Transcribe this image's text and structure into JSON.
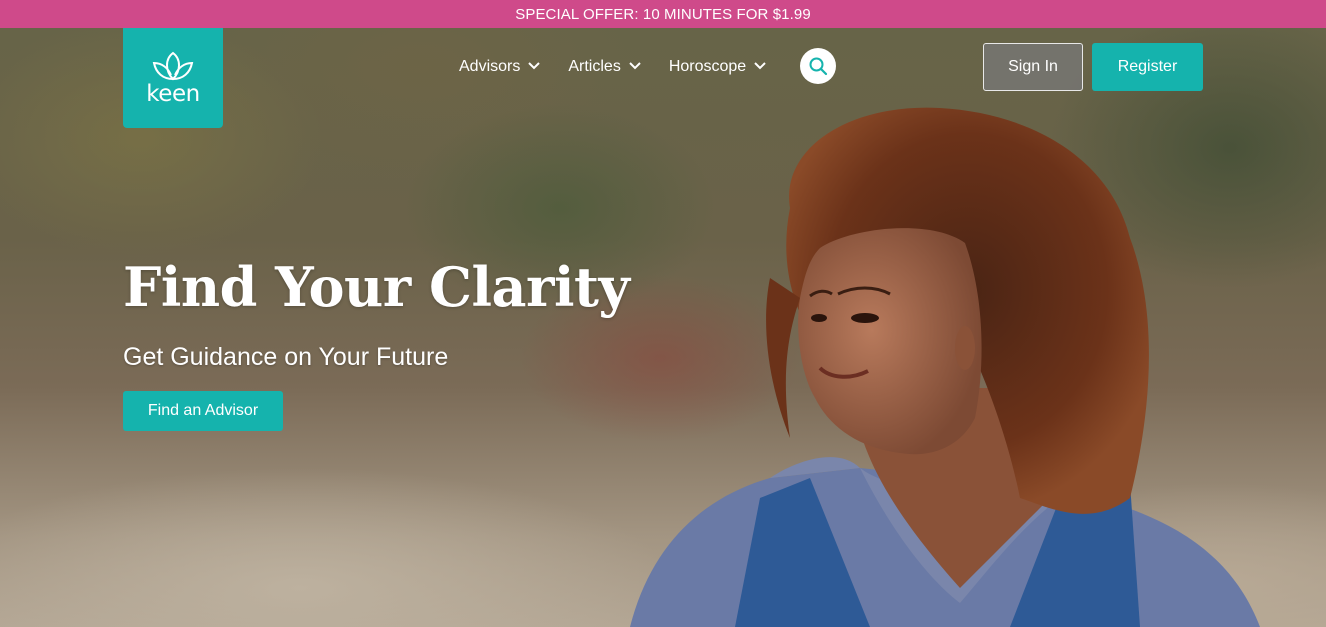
{
  "promo": {
    "text": "SPECIAL OFFER: 10 MINUTES FOR $1.99"
  },
  "brand": {
    "name": "keen",
    "color": "#15b3ad"
  },
  "nav": {
    "items": [
      {
        "label": "Advisors",
        "icon": "chevron-down-icon"
      },
      {
        "label": "Articles",
        "icon": "chevron-down-icon"
      },
      {
        "label": "Horoscope",
        "icon": "chevron-down-icon"
      }
    ],
    "search_icon": "search-icon"
  },
  "auth": {
    "signin_label": "Sign In",
    "register_label": "Register"
  },
  "hero": {
    "title": "Find Your Clarity",
    "subtitle": "Get Guidance on Your Future",
    "cta_label": "Find an Advisor",
    "image": "woman-portrait"
  },
  "colors": {
    "promo_bar": "#cf4a8a",
    "accent": "#15b3ad"
  }
}
